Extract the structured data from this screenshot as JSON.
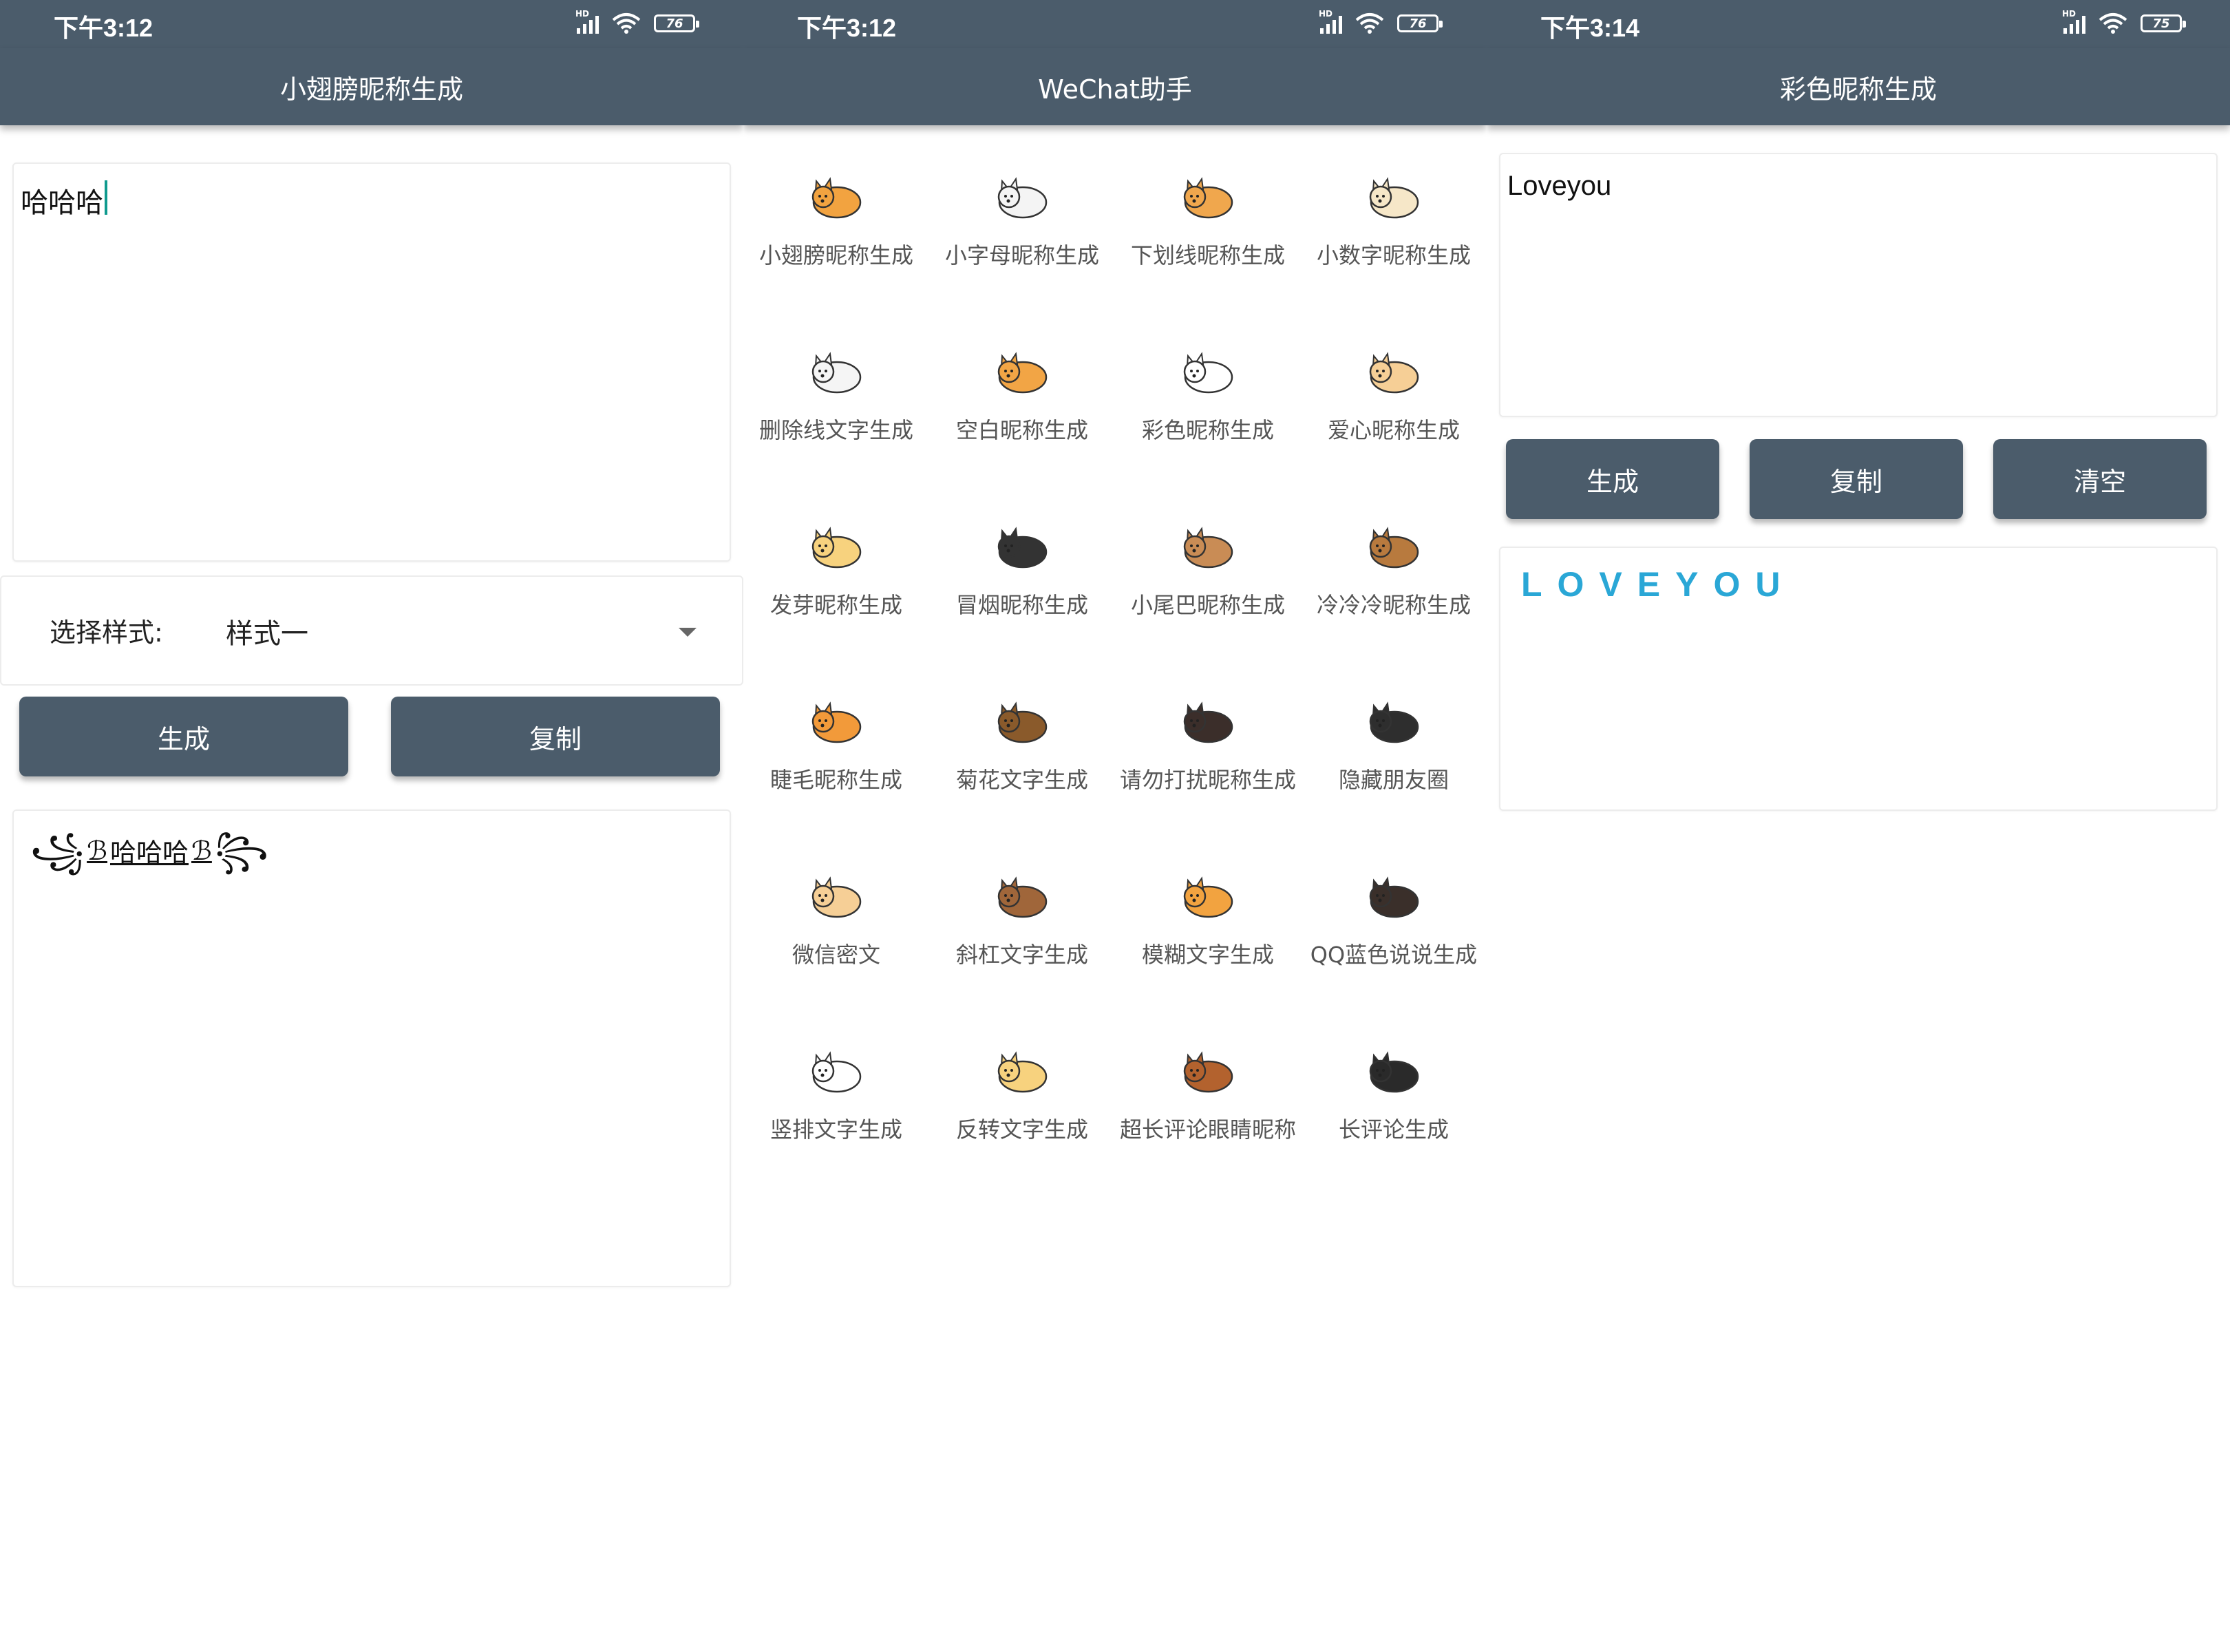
{
  "status_bars": [
    {
      "time": "下午3:12",
      "battery": "76",
      "signal_tag": "HD"
    },
    {
      "time": "下午3:12",
      "battery": "76",
      "signal_tag": "HD"
    },
    {
      "time": "下午3:14",
      "battery": "75",
      "signal_tag": "HD"
    }
  ],
  "screen1": {
    "title": "小翅膀昵称生成",
    "input_value": "哈哈哈",
    "select_label": "选择样式:",
    "select_value": "样式一",
    "generate_label": "生成",
    "copy_label": "复制",
    "output": {
      "deco_left": "꧁",
      "wing_left": "ℬ",
      "core": "哈哈哈",
      "wing_right": "ℬ",
      "deco_right": "꧂"
    }
  },
  "screen2": {
    "title": "WeChat助手",
    "items": [
      {
        "label": "小翅膀昵称生成",
        "icon": "corgi-icon",
        "color": "#f2a340"
      },
      {
        "label": "小字母昵称生成",
        "icon": "white-dog-icon",
        "color": "#f4f4f4"
      },
      {
        "label": "下划线昵称生成",
        "icon": "spotted-dog-icon",
        "color": "#f0a74d"
      },
      {
        "label": "小数字昵称生成",
        "icon": "sleeping-dog-icon",
        "color": "#f6e7c8"
      },
      {
        "label": "删除线文字生成",
        "icon": "bull-terrier-icon",
        "color": "#f5f5f5"
      },
      {
        "label": "空白昵称生成",
        "icon": "jack-russell-icon",
        "color": "#f2a545"
      },
      {
        "label": "彩色昵称生成",
        "icon": "poodle-icon",
        "color": "#ffffff"
      },
      {
        "label": "爱心昵称生成",
        "icon": "pug-icon",
        "color": "#f6cf96"
      },
      {
        "label": "发芽昵称生成",
        "icon": "golden-dog-icon",
        "color": "#f7d27e"
      },
      {
        "label": "冒烟昵称生成",
        "icon": "boston-terrier-icon",
        "color": "#333333"
      },
      {
        "label": "小尾巴昵称生成",
        "icon": "chihuahua-icon",
        "color": "#c98c55"
      },
      {
        "label": "冷冷冷昵称生成",
        "icon": "beagle-icon",
        "color": "#b87a3e"
      },
      {
        "label": "睫毛昵称生成",
        "icon": "shiba-icon",
        "color": "#f29a3a"
      },
      {
        "label": "菊花文字生成",
        "icon": "german-shepherd-icon",
        "color": "#8a5a2b"
      },
      {
        "label": "请勿打扰昵称生成",
        "icon": "dachshund-icon",
        "color": "#3b2e2a"
      },
      {
        "label": "隐藏朋友圈",
        "icon": "husky-icon",
        "color": "#2e2e2e"
      },
      {
        "label": "微信密文",
        "icon": "pug-face-icon",
        "color": "#f6cf96"
      },
      {
        "label": "斜杠文字生成",
        "icon": "cavalier-icon",
        "color": "#a0663a"
      },
      {
        "label": "模糊文字生成",
        "icon": "corgi-sitting-icon",
        "color": "#f2a340"
      },
      {
        "label": "QQ蓝色说说生成",
        "icon": "rottweiler-icon",
        "color": "#3a2f2a"
      },
      {
        "label": "竖排文字生成",
        "icon": "pomeranian-icon",
        "color": "#ffffff"
      },
      {
        "label": "反转文字生成",
        "icon": "golden-retriever-icon",
        "color": "#f7d27e"
      },
      {
        "label": "超长评论眼睛昵称",
        "icon": "chow-icon",
        "color": "#b3622e"
      },
      {
        "label": "长评论生成",
        "icon": "border-collie-icon",
        "color": "#2a2a2a"
      }
    ]
  },
  "screen3": {
    "title": "彩色昵称生成",
    "input_value": "Loveyou",
    "generate_label": "生成",
    "copy_label": "复制",
    "clear_label": "清空",
    "output_text": "LOVEYOU",
    "output_color": "#2aa7d6"
  },
  "colors": {
    "primary": "#4b5c6b",
    "cursor": "#0f9a8e"
  }
}
